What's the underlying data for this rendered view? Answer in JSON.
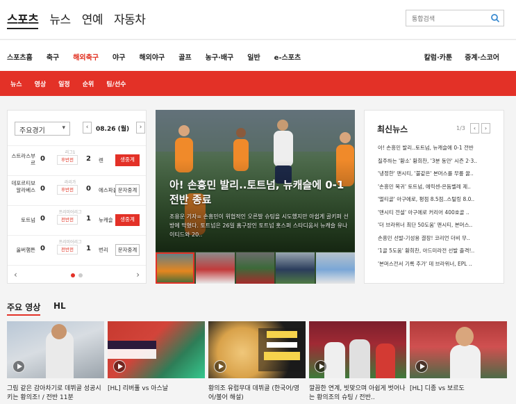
{
  "header": {
    "sections": [
      "스포츠",
      "뉴스",
      "연예",
      "자동차"
    ],
    "search_placeholder": "통합검색"
  },
  "nav": {
    "left": [
      "스포츠홈",
      "축구",
      "해외축구",
      "야구",
      "해외야구",
      "골프",
      "농구·배구",
      "일반",
      "e-스포츠"
    ],
    "right": [
      "칼럼·카툰",
      "중계·스코어"
    ],
    "active": "해외축구"
  },
  "subnav": [
    "뉴스",
    "영상",
    "일정",
    "순위",
    "팀/선수"
  ],
  "scores": {
    "select_label": "주요경기",
    "date": "08.26 (월)",
    "matches": [
      {
        "home": "스트라스부르",
        "home_score": "0",
        "league": "리그1",
        "state": "후반전",
        "away_score": "2",
        "away": "렌",
        "button": "생중계"
      },
      {
        "home": "데포르티보 알라베스",
        "home_score": "0",
        "league": "라리가",
        "state": "후반전",
        "away_score": "0",
        "away": "에스파뇰",
        "button": "문자중계"
      },
      {
        "home": "토트넘",
        "home_score": "0",
        "league": "프리미어리그",
        "state": "전반전",
        "away_score": "1",
        "away": "뉴캐슬",
        "button": "생중계"
      },
      {
        "home": "울버햄튼",
        "home_score": "0",
        "league": "프리미어리그",
        "state": "전반전",
        "away_score": "1",
        "away": "번리",
        "button": "문자중계"
      }
    ]
  },
  "hero": {
    "title": "아! 손흥민 발리..토트넘, 뉴캐슬에 0-1 전반 종료",
    "description": "조용운 기자= 손흥민이 위협적인 오른발 슈팅을 시도했지만 아쉽게 골키퍼 선방에 막혔다. 토트넘은 26일 홈구장인 토트넘 홋스퍼 스타디움서 뉴캐슬 유나이티드와 20.."
  },
  "news": {
    "title": "최신뉴스",
    "page": "1/3",
    "items": [
      "아! 손흥민 발리..토트넘, 뉴캐슬에 0-1 전반",
      "질주하는 '황소' 황희찬, '3분 동안' 시즌 2·3..",
      "'냉정한' 맨시티, '불같은' 본머스를 무릎 꿇..",
      "'손흥민 복귀' 토트넘, 에릭센-은돔벨레 제..",
      "'멀티골' 아구에로, 평점 8.5점..스털링 8.0..",
      "'맨시티 전설' 아구에로 커리어 400호골 ..",
      "'더 브라위너 최단 50도움' 맨시티, 본머스..",
      "손흥민 선발-기성용 결장! 코리언 더비 무..",
      "'1골 5도움' 황희찬, 아드미라전 선발 출격!..",
      "'본머스전서 기록 추가' 데 브라위너, EPL .."
    ]
  },
  "videos": {
    "tabs": [
      "주요 영상",
      "HL"
    ],
    "items": [
      {
        "caption": "그림 같은 감아차기로 데뷔골 성공시키는 황의조! / 전반 11분"
      },
      {
        "caption": "[HL] 리버풀 vs 아스날"
      },
      {
        "caption": "황의조 유럽무대 데뷔골 (한국어/영어/불어 해설)"
      },
      {
        "caption": "깔끔한 연계, 빗맞으며 아쉽게 벗어나는 황의조의 슈팅 / 전반.."
      },
      {
        "caption": "[HL] 디종 vs 보르도"
      }
    ]
  },
  "colors": {
    "accent": "#e33127"
  }
}
